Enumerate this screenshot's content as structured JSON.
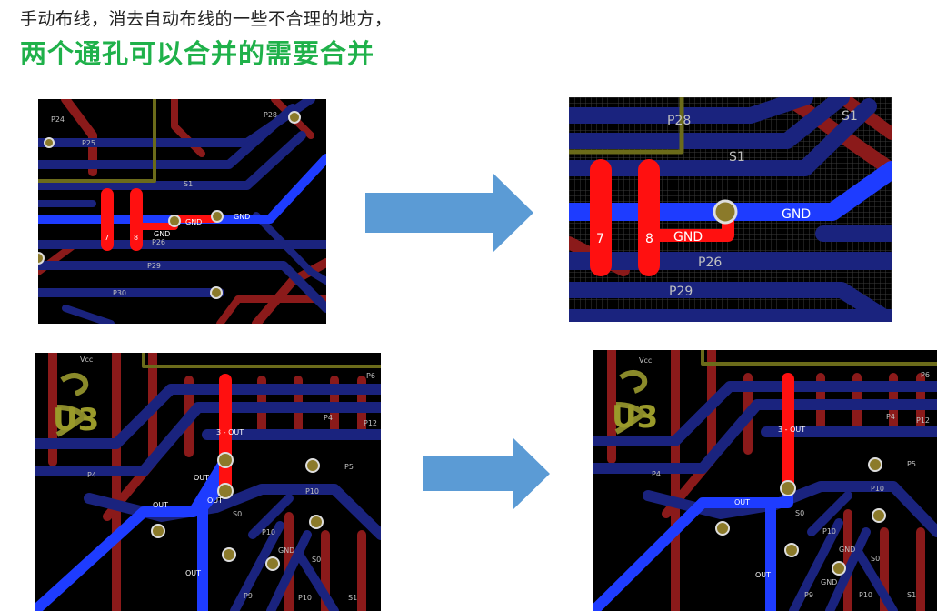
{
  "heading": {
    "line1": "手动布线，消去自动布线的一些不合理的地方，",
    "line2": "两个通孔可以合并的需要合并"
  },
  "colors": {
    "accent_green": "#1fb14a",
    "pcb_background": "#000000",
    "bottom_trace": "#1a237e",
    "top_trace": "#8b1a1a",
    "highlight_trace": "#1e3cff",
    "selected_pad": "#ff1010",
    "arrow_fill": "#5b9bd5"
  },
  "panel_top_left": {
    "nets": [
      "P24",
      "P25",
      "P28",
      "S1",
      "GND",
      "GND",
      "GND",
      "P26",
      "P29",
      "P30",
      "7",
      "8"
    ]
  },
  "panel_top_right": {
    "nets": [
      "P28",
      "S1",
      "GND",
      "GND",
      "P26",
      "P29",
      "7",
      "8",
      "S1"
    ]
  },
  "panel_bottom_left": {
    "nets": [
      "Vcc",
      "U3",
      "P6",
      "P12",
      "P4",
      "P4",
      "P5",
      "P10",
      "S0",
      "OUT",
      "OUT",
      "OUT",
      "3 - OUT",
      "P10",
      "GND",
      "S0",
      "OUT",
      "P9",
      "P10",
      "S1"
    ]
  },
  "panel_bottom_right": {
    "nets": [
      "Vcc",
      "U3",
      "P6",
      "P12",
      "P4",
      "P4",
      "P5",
      "P10",
      "S0",
      "OUT",
      "OUT",
      "3 - OUT",
      "P10",
      "GND",
      "S0",
      "P9",
      "P10",
      "GND",
      "S1"
    ]
  },
  "icons": [
    "right-arrow-icon",
    "right-arrow-icon"
  ]
}
